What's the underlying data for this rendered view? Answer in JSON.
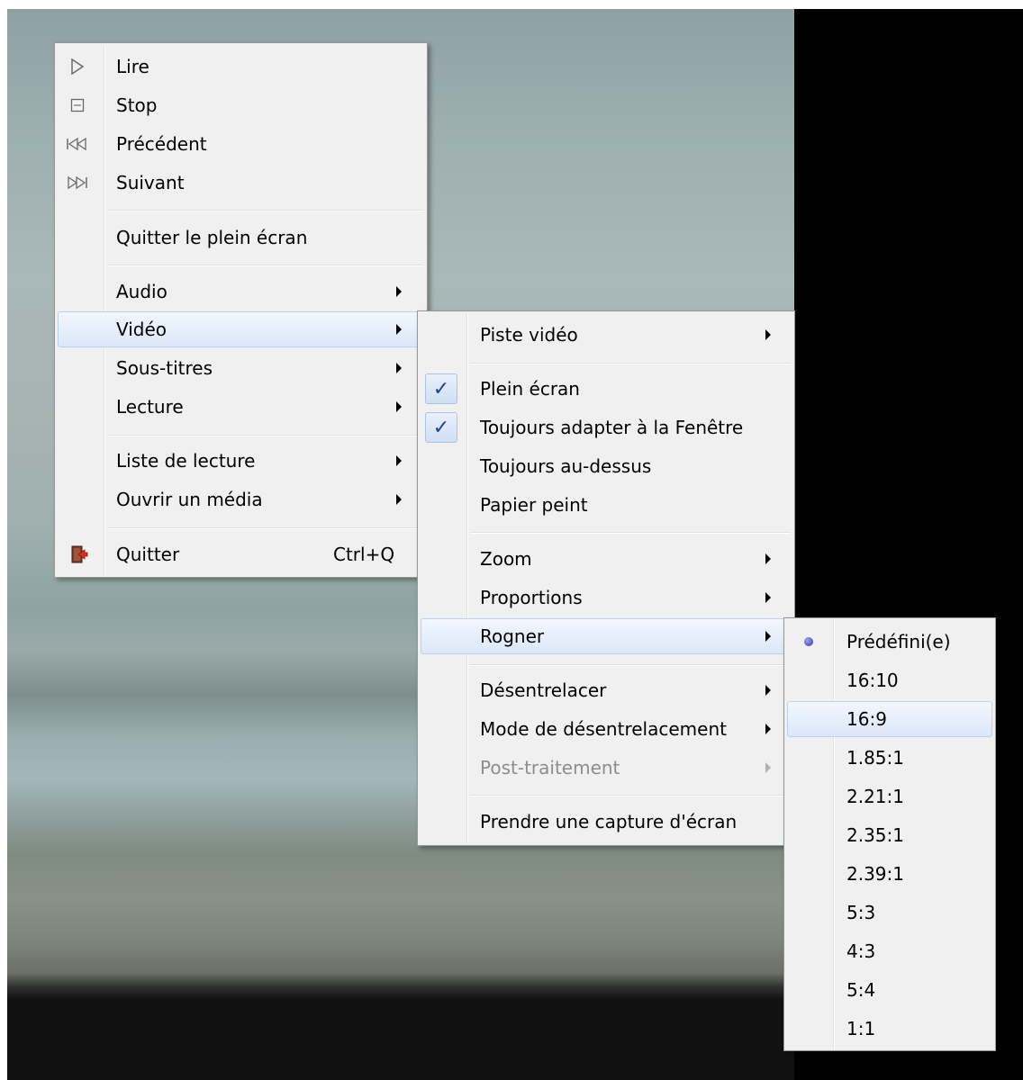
{
  "menu_main": {
    "items": {
      "play": "Lire",
      "stop": "Stop",
      "previous": "Précédent",
      "next": "Suivant",
      "exit_fullscreen": "Quitter le plein écran",
      "audio": "Audio",
      "video": "Vidéo",
      "subtitles": "Sous-titres",
      "playback": "Lecture",
      "playlist": "Liste de lecture",
      "open_media": "Ouvrir un média",
      "quit": "Quitter",
      "quit_shortcut": "Ctrl+Q"
    }
  },
  "menu_video": {
    "items": {
      "video_track": "Piste vidéo",
      "fullscreen": "Plein écran",
      "fit_window": "Toujours adapter à la Fenêtre",
      "always_on_top": "Toujours au-dessus",
      "wallpaper": "Papier peint",
      "zoom": "Zoom",
      "aspect_ratio": "Proportions",
      "crop": "Rogner",
      "deinterlace": "Désentrelacer",
      "deinterlace_mode": "Mode de désentrelacement",
      "post_processing": "Post-traitement",
      "snapshot": "Prendre une capture d'écran"
    },
    "checked": [
      "fullscreen",
      "fit_window"
    ],
    "disabled": [
      "post_processing"
    ]
  },
  "menu_crop": {
    "items": [
      "Prédéfini(e)",
      "16:10",
      "16:9",
      "1.85:1",
      "2.21:1",
      "2.35:1",
      "2.39:1",
      "5:3",
      "4:3",
      "5:4",
      "1:1"
    ],
    "selected": "Prédéfini(e)",
    "highlighted": "16:9"
  },
  "colors": {
    "menu_bg": "#f0f0f0",
    "hover_border": "#b8d2f0",
    "check": "#1f3f9a"
  }
}
